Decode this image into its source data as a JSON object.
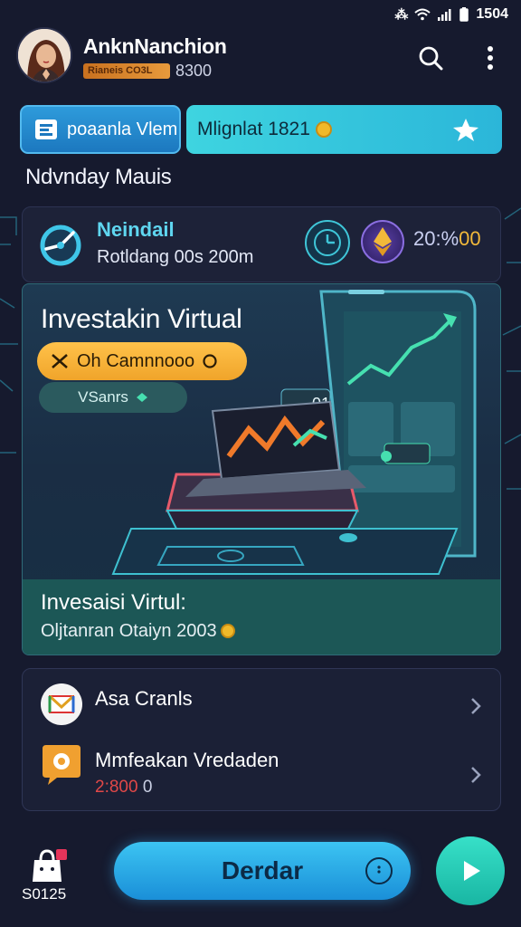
{
  "status_bar": {
    "time": "1504"
  },
  "profile": {
    "name": "AnknNanchion",
    "badge": "Rianeis CO3L",
    "value": "8300"
  },
  "tabs": {
    "primary": "poaanla Vlem",
    "secondary": "Mlignlat 1821"
  },
  "section_title": "Ndvnday Mauis",
  "notice": {
    "title": "Neindail",
    "subtitle": "Rotldang 00s 200m",
    "percent": "20:%",
    "percent_suffix": "00"
  },
  "hero": {
    "title": "Investakin Virtual",
    "cta_label": "Oh Camnnooo",
    "chip_label": "VSanrs",
    "floating_badge": "01",
    "footer_title": "Invesaisi Virtul:",
    "footer_subtitle": "Oljtanran Otaiyn 2003"
  },
  "list": {
    "items": [
      {
        "label": "Asa Cranls",
        "icon": "envelope-icon"
      },
      {
        "label": "Mmfeakan Vredaden",
        "sub_red": "2:800",
        "sub_rest": "0",
        "icon": "chat-gear-icon"
      }
    ]
  },
  "bottom": {
    "bag_label": "S0125",
    "main_button": "Derdar"
  },
  "colors": {
    "background": "#161a2e",
    "accent_blue": "#1a8fd8",
    "accent_teal": "#19b6a3",
    "accent_orange": "#f0a42a"
  }
}
